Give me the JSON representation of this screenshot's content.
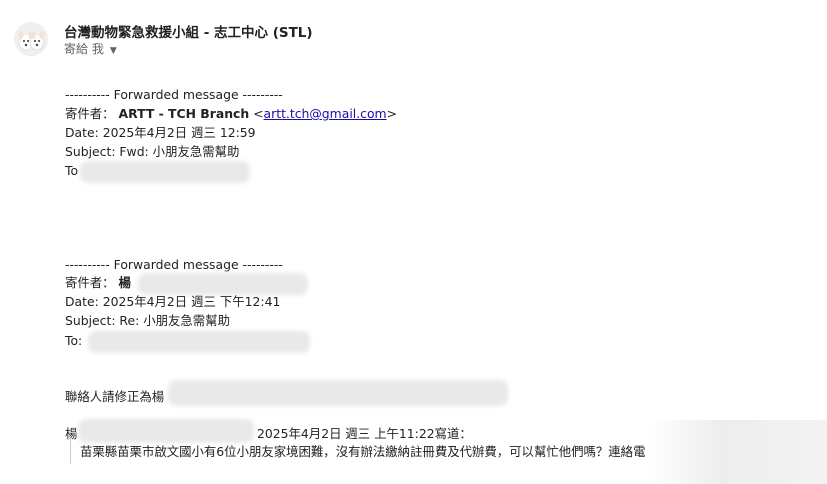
{
  "header": {
    "sender_name": "台灣動物緊急救援小組 - 志工中心 (STL)",
    "recipient_label": "寄給 我",
    "avatar_icon": "dogs-avatar-icon"
  },
  "forward1": {
    "separator": "---------- Forwarded message ---------",
    "from_label": "寄件者：",
    "from_name": "ARTT - TCH Branch",
    "from_email_prefix": "<",
    "from_email": "artt.tch@gmail.com",
    "from_email_suffix": ">",
    "date_line": "Date: 2025年4月2日 週三 12:59",
    "subject_line": "Subject: Fwd: 小朋友急需幫助",
    "to_label": "To"
  },
  "forward2": {
    "separator": "---------- Forwarded message ---------",
    "from_label": "寄件者：",
    "from_name": "楊",
    "date_line": "Date: 2025年4月2日 週三 下午12:41",
    "subject_line": "Subject: Re: 小朋友急需幫助",
    "to_label": "To:"
  },
  "body": {
    "contact_line": "聯絡人請修正為楊",
    "quote_intro_prefix": "楊",
    "quote_intro_suffix": "2025年4月2日 週三 上午11:22寫道：",
    "quote_text": "苗栗縣苗栗市啟文國小有6位小朋友家境困難，沒有辦法繳納註冊費及代辦費，可以幫忙他們嗎？連絡電"
  }
}
